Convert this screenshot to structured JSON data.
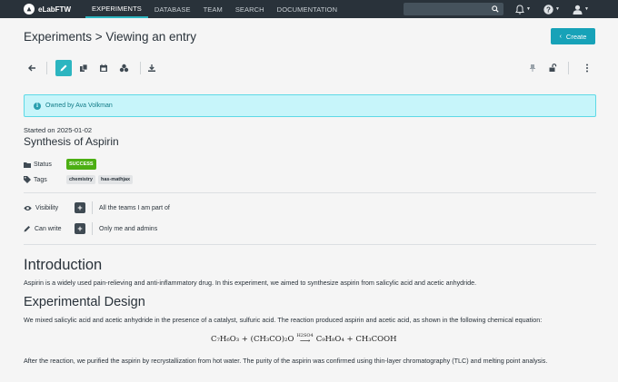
{
  "navbar": {
    "brand": "eLabFTW",
    "links": [
      "EXPERIMENTS",
      "DATABASE",
      "TEAM",
      "SEARCH",
      "DOCUMENTATION"
    ],
    "active": "EXPERIMENTS",
    "search_value": "",
    "icons": [
      "search-icon",
      "bell-icon",
      "help-icon",
      "user-icon"
    ]
  },
  "header": {
    "title": "Experiments > Viewing an entry",
    "create_label": "Create"
  },
  "toolbar": {
    "buttons": [
      "back-icon",
      "edit-icon",
      "duplicate-icon",
      "calendar-icon",
      "bookmarks-icon",
      "download-icon",
      "pin-icon",
      "lock-icon",
      "more-icon"
    ]
  },
  "entry": {
    "owner_text": "Owned by Ava Volkman",
    "started": "Started on 2025-01-02",
    "title": "Synthesis of Aspirin",
    "status_label": "Status",
    "status": "SUCCESS",
    "tags_label": "Tags",
    "tags": [
      "chemistry",
      "has-mathjax"
    ],
    "visibility_label": "Visibility",
    "visibility_value": "All the teams I am part of",
    "canwrite_label": "Can write",
    "canwrite_value": "Only me and admins"
  },
  "body": {
    "intro_heading": "Introduction",
    "intro_text": "Aspirin is a widely used pain-relieving and anti-inflammatory drug. In this experiment, we aimed to synthesize aspirin from salicylic acid and acetic anhydride.",
    "design_heading": "Experimental Design",
    "design_text": "We mixed salicylic acid and acetic anhydride in the presence of a catalyst, sulfuric acid. The reaction produced aspirin and acetic acid, as shown in the following chemical equation:",
    "equation": {
      "reactants": "C₇H₆O₃ + (CH₃CO)₂O",
      "catalyst": "H2SO4",
      "products": "C₉H₈O₄ + CH₃COOH"
    },
    "after_text": "After the reaction, we purified the aspirin by recrystallization from hot water. The purity of the aspirin was confirmed using thin-layer chromatography (TLC) and melting point analysis."
  },
  "colors": {
    "navbar": "#29323a",
    "accent": "#2cb5c0",
    "create_button": "#17a2b8",
    "success": "#4caf13",
    "banner_bg": "#c7f5fa"
  }
}
